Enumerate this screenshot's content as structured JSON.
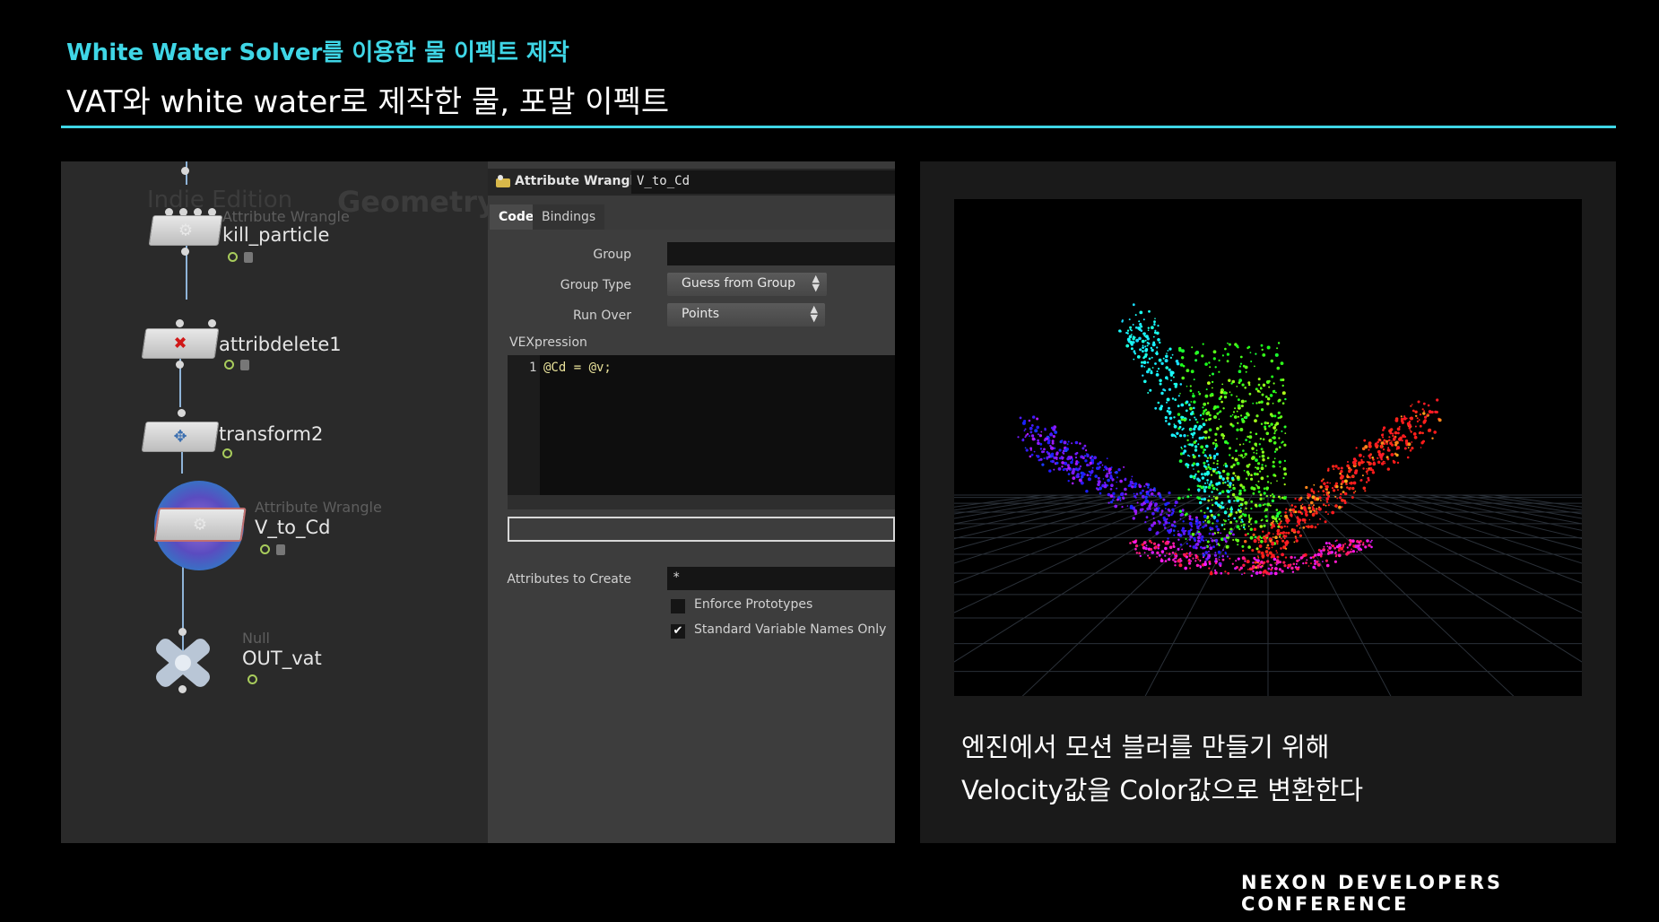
{
  "slide": {
    "subtitle": "White Water Solver를 이용한 물 이펙트 제작",
    "title": "VAT와 white water로 제작한 물, 포말 이펙트",
    "footer": "NEXON DEVELOPERS CONFERENCE"
  },
  "network": {
    "watermark_edition": "Indie Edition",
    "watermark_context": "Geometry",
    "nodes": [
      {
        "type": "Attribute Wrangle",
        "name": "kill_particle"
      },
      {
        "type": "",
        "name": "attribdelete1"
      },
      {
        "type": "",
        "name": "transform2"
      },
      {
        "type": "Attribute Wrangle",
        "name": "V_to_Cd"
      },
      {
        "type": "Null",
        "name": "OUT_vat"
      }
    ]
  },
  "params": {
    "header_type": "Attribute Wrangle",
    "header_name": "V_to_Cd",
    "tabs": [
      "Code",
      "Bindings"
    ],
    "group_label": "Group",
    "group_value": "",
    "group_type_label": "Group Type",
    "group_type_value": "Guess from Group",
    "run_over_label": "Run Over",
    "run_over_value": "Points",
    "vex_label": "VEXpression",
    "code_line_no": "1",
    "code": "@Cd = @v;",
    "attrs_create_label": "Attributes to Create",
    "attrs_create_value": "*",
    "enforce_label": "Enforce Prototypes",
    "enforce_checked": false,
    "std_names_label": "Standard Variable Names Only",
    "std_names_checked": true,
    "check_mark": "✔"
  },
  "viewport": {
    "caption_line1": "엔진에서 모션 블러를 만들기 위해",
    "caption_line2": "Velocity값을 Color값으로 변환한다"
  },
  "colors": {
    "accent": "#3fd6e6",
    "node_flag": "#a8cc5c",
    "code_text": "#e9e29a",
    "selected_node_ring": "#3a6fc4"
  }
}
